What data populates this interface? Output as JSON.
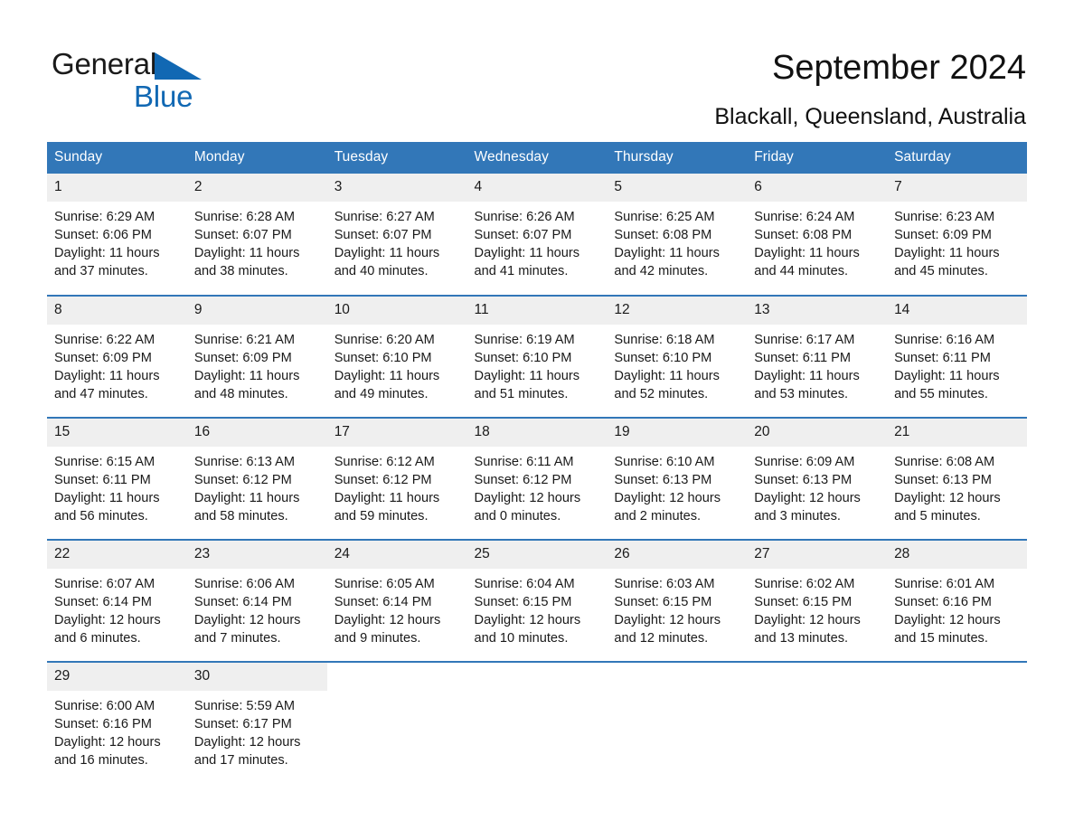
{
  "brand": {
    "name_part1": "General",
    "name_part2": "Blue",
    "triangle_color": "#1168b3",
    "accent_color": "#3277b8"
  },
  "header": {
    "title": "September 2024",
    "subtitle": "Blackall, Queensland, Australia"
  },
  "calendar": {
    "weekday_headers": [
      "Sunday",
      "Monday",
      "Tuesday",
      "Wednesday",
      "Thursday",
      "Friday",
      "Saturday"
    ],
    "labels": {
      "sunrise_prefix": "Sunrise: ",
      "sunset_prefix": "Sunset: ",
      "daylight_prefix": "Daylight: "
    },
    "weeks": [
      [
        {
          "day": "1",
          "sunrise": "Sunrise: 6:29 AM",
          "sunset": "Sunset: 6:06 PM",
          "daylight": "Daylight: 11 hours and 37 minutes."
        },
        {
          "day": "2",
          "sunrise": "Sunrise: 6:28 AM",
          "sunset": "Sunset: 6:07 PM",
          "daylight": "Daylight: 11 hours and 38 minutes."
        },
        {
          "day": "3",
          "sunrise": "Sunrise: 6:27 AM",
          "sunset": "Sunset: 6:07 PM",
          "daylight": "Daylight: 11 hours and 40 minutes."
        },
        {
          "day": "4",
          "sunrise": "Sunrise: 6:26 AM",
          "sunset": "Sunset: 6:07 PM",
          "daylight": "Daylight: 11 hours and 41 minutes."
        },
        {
          "day": "5",
          "sunrise": "Sunrise: 6:25 AM",
          "sunset": "Sunset: 6:08 PM",
          "daylight": "Daylight: 11 hours and 42 minutes."
        },
        {
          "day": "6",
          "sunrise": "Sunrise: 6:24 AM",
          "sunset": "Sunset: 6:08 PM",
          "daylight": "Daylight: 11 hours and 44 minutes."
        },
        {
          "day": "7",
          "sunrise": "Sunrise: 6:23 AM",
          "sunset": "Sunset: 6:09 PM",
          "daylight": "Daylight: 11 hours and 45 minutes."
        }
      ],
      [
        {
          "day": "8",
          "sunrise": "Sunrise: 6:22 AM",
          "sunset": "Sunset: 6:09 PM",
          "daylight": "Daylight: 11 hours and 47 minutes."
        },
        {
          "day": "9",
          "sunrise": "Sunrise: 6:21 AM",
          "sunset": "Sunset: 6:09 PM",
          "daylight": "Daylight: 11 hours and 48 minutes."
        },
        {
          "day": "10",
          "sunrise": "Sunrise: 6:20 AM",
          "sunset": "Sunset: 6:10 PM",
          "daylight": "Daylight: 11 hours and 49 minutes."
        },
        {
          "day": "11",
          "sunrise": "Sunrise: 6:19 AM",
          "sunset": "Sunset: 6:10 PM",
          "daylight": "Daylight: 11 hours and 51 minutes."
        },
        {
          "day": "12",
          "sunrise": "Sunrise: 6:18 AM",
          "sunset": "Sunset: 6:10 PM",
          "daylight": "Daylight: 11 hours and 52 minutes."
        },
        {
          "day": "13",
          "sunrise": "Sunrise: 6:17 AM",
          "sunset": "Sunset: 6:11 PM",
          "daylight": "Daylight: 11 hours and 53 minutes."
        },
        {
          "day": "14",
          "sunrise": "Sunrise: 6:16 AM",
          "sunset": "Sunset: 6:11 PM",
          "daylight": "Daylight: 11 hours and 55 minutes."
        }
      ],
      [
        {
          "day": "15",
          "sunrise": "Sunrise: 6:15 AM",
          "sunset": "Sunset: 6:11 PM",
          "daylight": "Daylight: 11 hours and 56 minutes."
        },
        {
          "day": "16",
          "sunrise": "Sunrise: 6:13 AM",
          "sunset": "Sunset: 6:12 PM",
          "daylight": "Daylight: 11 hours and 58 minutes."
        },
        {
          "day": "17",
          "sunrise": "Sunrise: 6:12 AM",
          "sunset": "Sunset: 6:12 PM",
          "daylight": "Daylight: 11 hours and 59 minutes."
        },
        {
          "day": "18",
          "sunrise": "Sunrise: 6:11 AM",
          "sunset": "Sunset: 6:12 PM",
          "daylight": "Daylight: 12 hours and 0 minutes."
        },
        {
          "day": "19",
          "sunrise": "Sunrise: 6:10 AM",
          "sunset": "Sunset: 6:13 PM",
          "daylight": "Daylight: 12 hours and 2 minutes."
        },
        {
          "day": "20",
          "sunrise": "Sunrise: 6:09 AM",
          "sunset": "Sunset: 6:13 PM",
          "daylight": "Daylight: 12 hours and 3 minutes."
        },
        {
          "day": "21",
          "sunrise": "Sunrise: 6:08 AM",
          "sunset": "Sunset: 6:13 PM",
          "daylight": "Daylight: 12 hours and 5 minutes."
        }
      ],
      [
        {
          "day": "22",
          "sunrise": "Sunrise: 6:07 AM",
          "sunset": "Sunset: 6:14 PM",
          "daylight": "Daylight: 12 hours and 6 minutes."
        },
        {
          "day": "23",
          "sunrise": "Sunrise: 6:06 AM",
          "sunset": "Sunset: 6:14 PM",
          "daylight": "Daylight: 12 hours and 7 minutes."
        },
        {
          "day": "24",
          "sunrise": "Sunrise: 6:05 AM",
          "sunset": "Sunset: 6:14 PM",
          "daylight": "Daylight: 12 hours and 9 minutes."
        },
        {
          "day": "25",
          "sunrise": "Sunrise: 6:04 AM",
          "sunset": "Sunset: 6:15 PM",
          "daylight": "Daylight: 12 hours and 10 minutes."
        },
        {
          "day": "26",
          "sunrise": "Sunrise: 6:03 AM",
          "sunset": "Sunset: 6:15 PM",
          "daylight": "Daylight: 12 hours and 12 minutes."
        },
        {
          "day": "27",
          "sunrise": "Sunrise: 6:02 AM",
          "sunset": "Sunset: 6:15 PM",
          "daylight": "Daylight: 12 hours and 13 minutes."
        },
        {
          "day": "28",
          "sunrise": "Sunrise: 6:01 AM",
          "sunset": "Sunset: 6:16 PM",
          "daylight": "Daylight: 12 hours and 15 minutes."
        }
      ],
      [
        {
          "day": "29",
          "sunrise": "Sunrise: 6:00 AM",
          "sunset": "Sunset: 6:16 PM",
          "daylight": "Daylight: 12 hours and 16 minutes."
        },
        {
          "day": "30",
          "sunrise": "Sunrise: 5:59 AM",
          "sunset": "Sunset: 6:17 PM",
          "daylight": "Daylight: 12 hours and 17 minutes."
        },
        null,
        null,
        null,
        null,
        null
      ]
    ]
  }
}
